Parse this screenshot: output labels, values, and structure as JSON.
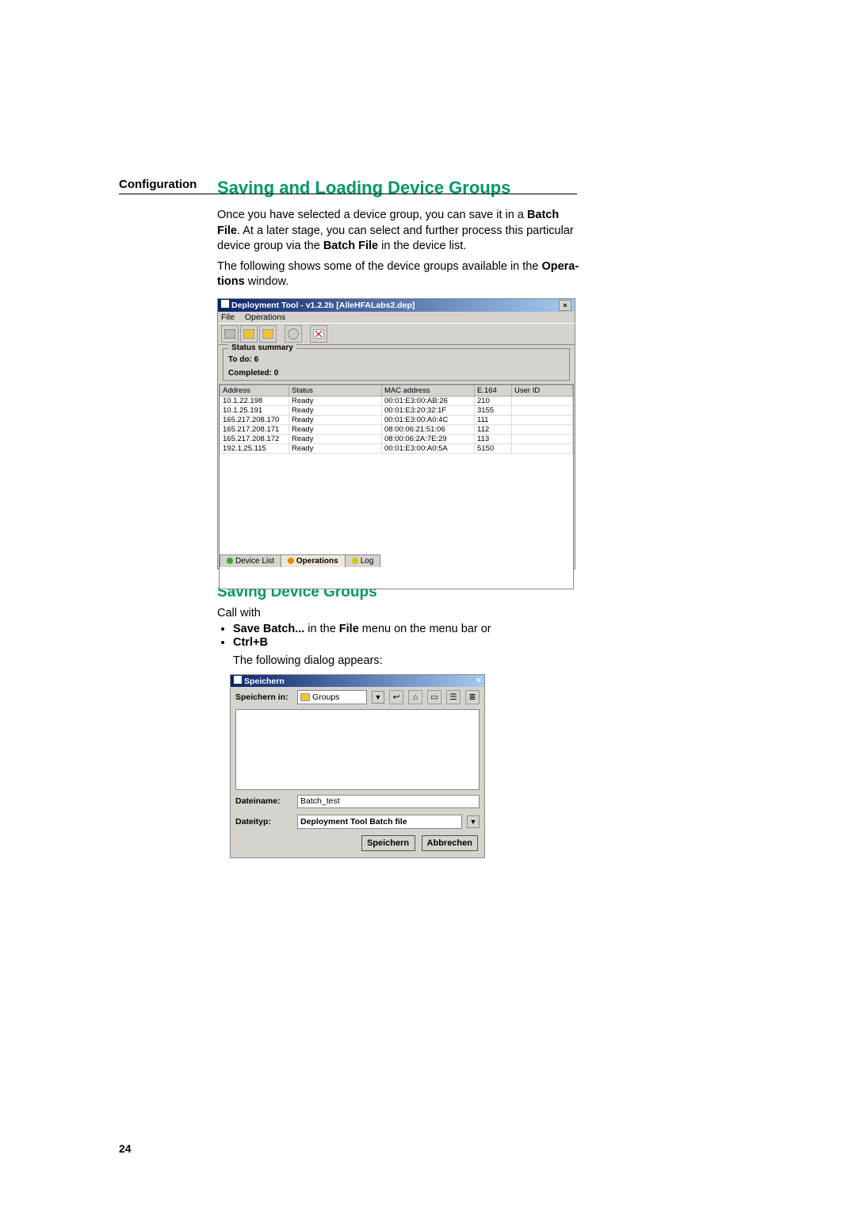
{
  "side_label": "Configuration",
  "page_number": "24",
  "h2_title": "Saving and Loading Device Groups",
  "intro_p1a": "Once you have selected a device group, you can save it in a ",
  "intro_p1_bold1": "Batch File",
  "intro_p1b": ". At a later stage, you can select and further process this particular device group via the ",
  "intro_p1_bold2": "Batch File",
  "intro_p1c": " in the device list.",
  "intro_p2a": "The following shows some of the  device groups available in the ",
  "intro_p2_bold": "Opera­tions",
  "intro_p2b": " window.",
  "op_window": {
    "title": "Deployment Tool - v1.2.2b  [AlleHFALabs2.dep]",
    "menu_file": "File",
    "menu_ops": "Operations",
    "status_legend": "Status summary",
    "status_todo": "To do: 6",
    "status_done": "Completed: 0",
    "headers": {
      "addr": "Address",
      "status": "Status",
      "mac": "MAC address",
      "e164": "E.164",
      "uid": "User ID"
    },
    "rows": [
      {
        "addr": "10.1.22.198",
        "status": "Ready",
        "mac": "00:01:E3:00:AB:26",
        "e164": "210",
        "uid": ""
      },
      {
        "addr": "10.1.25.191",
        "status": "Ready",
        "mac": "00:01:E3:20:32:1F",
        "e164": "3155",
        "uid": ""
      },
      {
        "addr": "165.217.208.170",
        "status": "Ready",
        "mac": "00:01:E3:00:A0:4C",
        "e164": "111",
        "uid": ""
      },
      {
        "addr": "165.217.208.171",
        "status": "Ready",
        "mac": "08:00:06:21:51:06",
        "e164": "112",
        "uid": ""
      },
      {
        "addr": "165.217.208.172",
        "status": "Ready",
        "mac": "08:00:06:2A:7E:29",
        "e164": "113",
        "uid": ""
      },
      {
        "addr": "192.1.25.115",
        "status": "Ready",
        "mac": "00:01:E3:00:A0:5A",
        "e164": "5150",
        "uid": ""
      }
    ],
    "tab_device": "Device List",
    "tab_ops": "Operations",
    "tab_log": "Log"
  },
  "h3_title": "Saving Device Groups",
  "callwith": "Call with",
  "li1a": "Save Batch...",
  "li1b": " in the ",
  "li1c": "File",
  "li1d": " menu on the menu bar or",
  "li2": "Ctrl+B",
  "following_dlg": "The following dialog appears:",
  "save_dialog": {
    "title": "Speichern",
    "lookin_label": "Speichern in:",
    "lookin_value": "Groups",
    "filename_label": "Dateiname:",
    "filename_value": "Batch_test",
    "filetype_label": "Dateityp:",
    "filetype_value": "Deployment Tool Batch file",
    "btn_save": "Speichern",
    "btn_cancel": "Abbrechen"
  }
}
